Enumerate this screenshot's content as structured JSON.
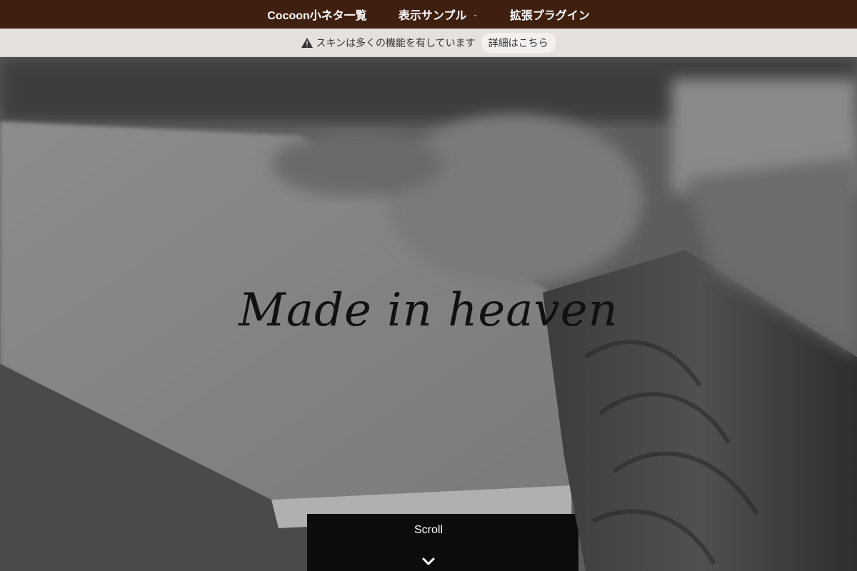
{
  "nav": {
    "items": [
      {
        "label": "Cocoon小ネタ一覧",
        "has_dropdown": false
      },
      {
        "label": "表示サンプル",
        "has_dropdown": true
      },
      {
        "label": "拡張プラグイン",
        "has_dropdown": false
      }
    ],
    "dropdown_glyph": "⌄"
  },
  "notice": {
    "icon": "warning-icon",
    "message": "スキンは多くの機能を有しています",
    "detail_label": "詳細はこちら"
  },
  "hero": {
    "title": "Made in heaven",
    "scroll_label": "Scroll",
    "scroll_icon": "chevron-down-icon"
  },
  "colors": {
    "nav_bg": "#3f1f10",
    "notice_bg": "#e6e1de",
    "title": "#111111"
  }
}
